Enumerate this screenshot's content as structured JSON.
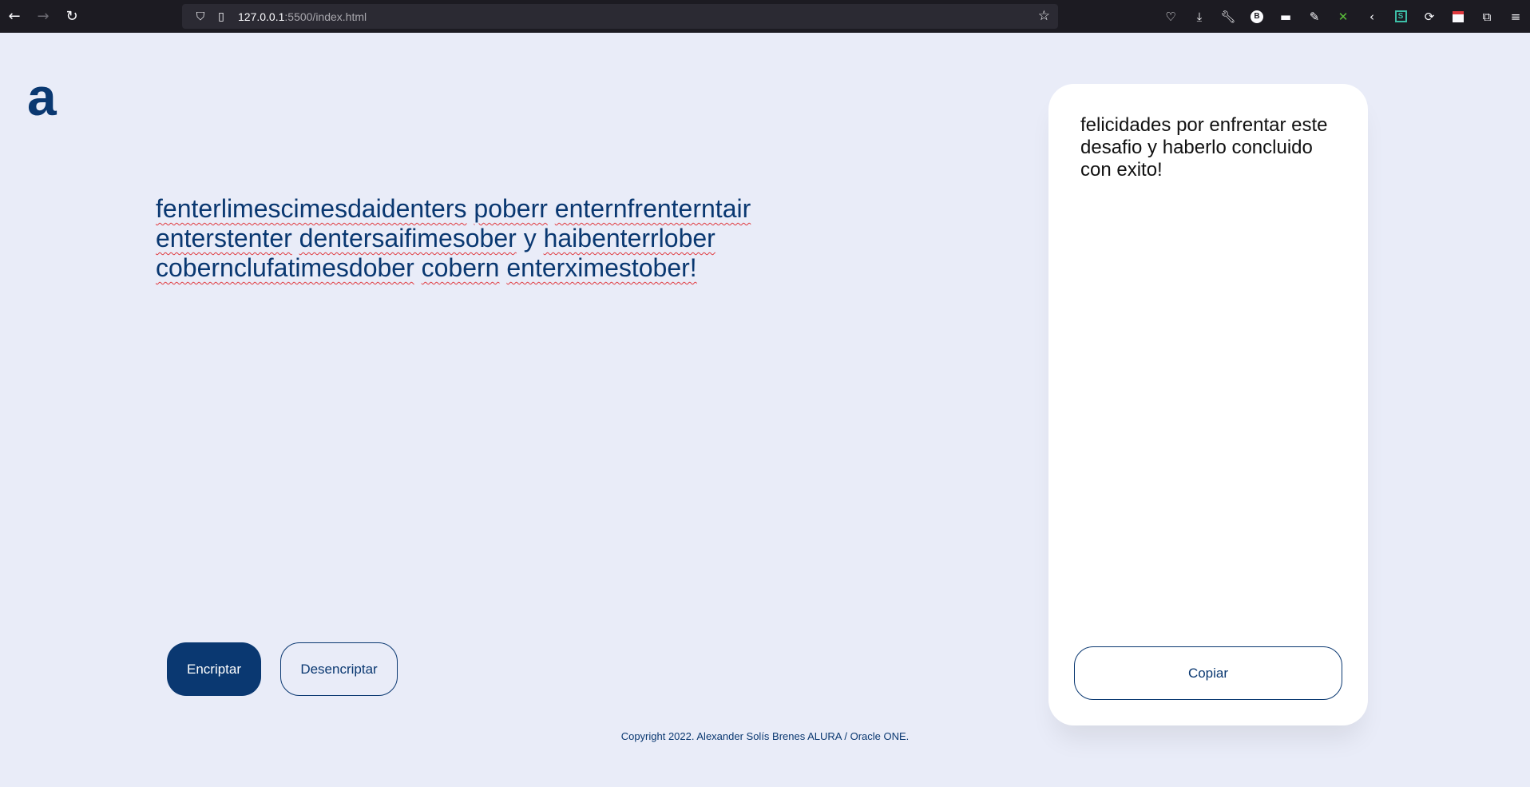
{
  "browser": {
    "url_host": "127.0.0.1",
    "url_path": ":5500/index.html",
    "extension_badge": "B",
    "extension_square": "S"
  },
  "page": {
    "logo": "a",
    "input_words": [
      "fenterlimescimesdaidenters",
      "poberr",
      "enternfrenterntair",
      "enterstenter",
      "dentersaifimesober",
      "y",
      "haibenterrlober",
      "cobernclufatimesdober",
      "cobern",
      "enterximestober!"
    ],
    "buttons": {
      "encrypt": "Encriptar",
      "decrypt": "Desencriptar",
      "copy": "Copiar"
    },
    "output_text": "felicidades por enfrentar este desafio y haberlo concluido con exito!",
    "footer": "Copyright 2022. Alexander Solís Brenes ALURA / Oracle ONE."
  },
  "colors": {
    "brand": "#0a3871",
    "background": "#e9ecf8",
    "panel": "#ffffff"
  },
  "icons": [
    "back-arrow-icon",
    "forward-arrow-icon",
    "reload-icon",
    "shield-icon",
    "page-icon",
    "bookmark-star-icon",
    "pocket-icon",
    "download-icon",
    "wrench-icon",
    "extension-icon",
    "menu-icon"
  ]
}
